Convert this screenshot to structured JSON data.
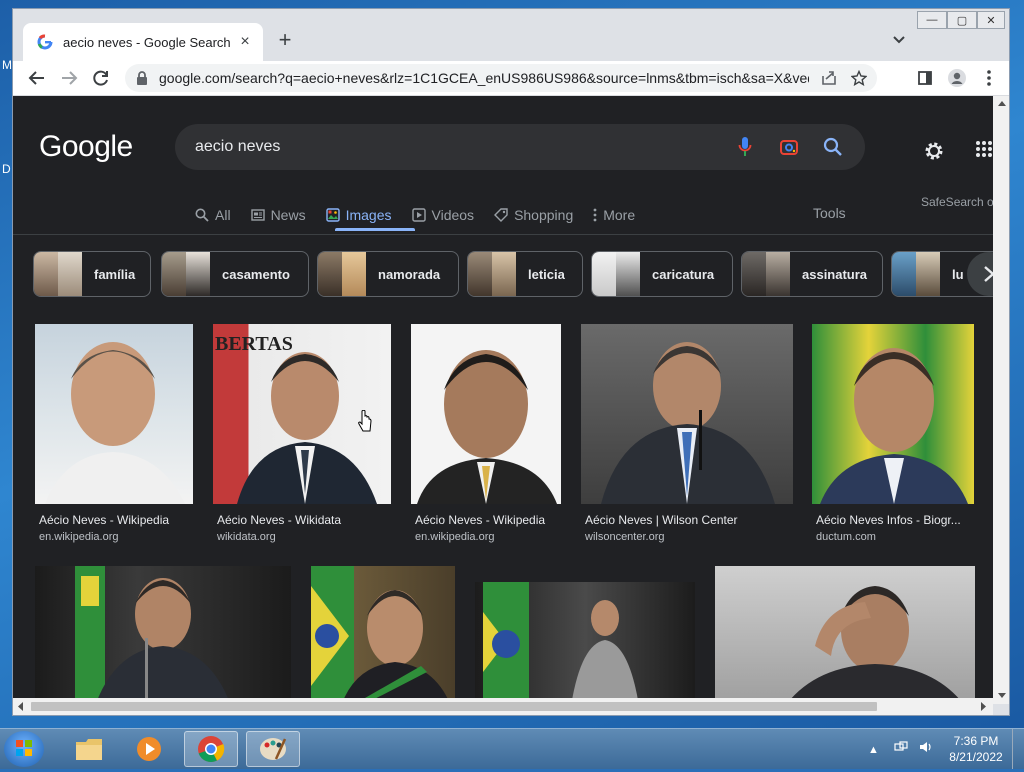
{
  "desktop": {
    "frag1": "M",
    "frag2": "D"
  },
  "window_controls": {
    "minimize": "—",
    "maximize": "▢",
    "close": "✕"
  },
  "tab": {
    "title": "aecio neves - Google Search",
    "close": "×"
  },
  "new_tab_label": "+",
  "tab_search_label": "⌄",
  "address_bar": {
    "url": "google.com/search?q=aecio+neves&rlz=1C1GCEA_enUS986US986&source=lnms&tbm=isch&sa=X&ved=2..."
  },
  "google": {
    "logo": "Google",
    "query": "aecio neves",
    "nav": [
      {
        "label": "All",
        "icon": "search-icon"
      },
      {
        "label": "News",
        "icon": "news-icon"
      },
      {
        "label": "Images",
        "icon": "images-icon",
        "active": true
      },
      {
        "label": "Videos",
        "icon": "video-icon"
      },
      {
        "label": "Shopping",
        "icon": "tag-icon"
      },
      {
        "label": "More",
        "icon": "more-vert-icon"
      }
    ],
    "tools": "Tools",
    "safesearch": "SafeSearch o",
    "chips": [
      "família",
      "casamento",
      "namorada",
      "leticia",
      "caricatura",
      "assinatura",
      "lu"
    ],
    "results_row1": [
      {
        "title": "Aécio Neves - Wikipedia",
        "source": "en.wikipedia.org"
      },
      {
        "title": "Aécio Neves - Wikidata",
        "source": "wikidata.org"
      },
      {
        "title": "Aécio Neves - Wikipedia",
        "source": "en.wikipedia.org"
      },
      {
        "title": "Aécio Neves | Wilson Center",
        "source": "wilsoncenter.org"
      },
      {
        "title": "Aécio Neves Infos - Biogr...",
        "source": "ductum.com"
      }
    ]
  },
  "taskbar": {
    "apps": [
      "file-explorer",
      "media-player",
      "chrome",
      "paint"
    ],
    "time": "7:36 PM",
    "date": "8/21/2022",
    "tray_arrow": "▲"
  },
  "colors": {
    "page_bg": "#202124",
    "accent": "#8ab4f8",
    "text": "#e8eaed"
  }
}
